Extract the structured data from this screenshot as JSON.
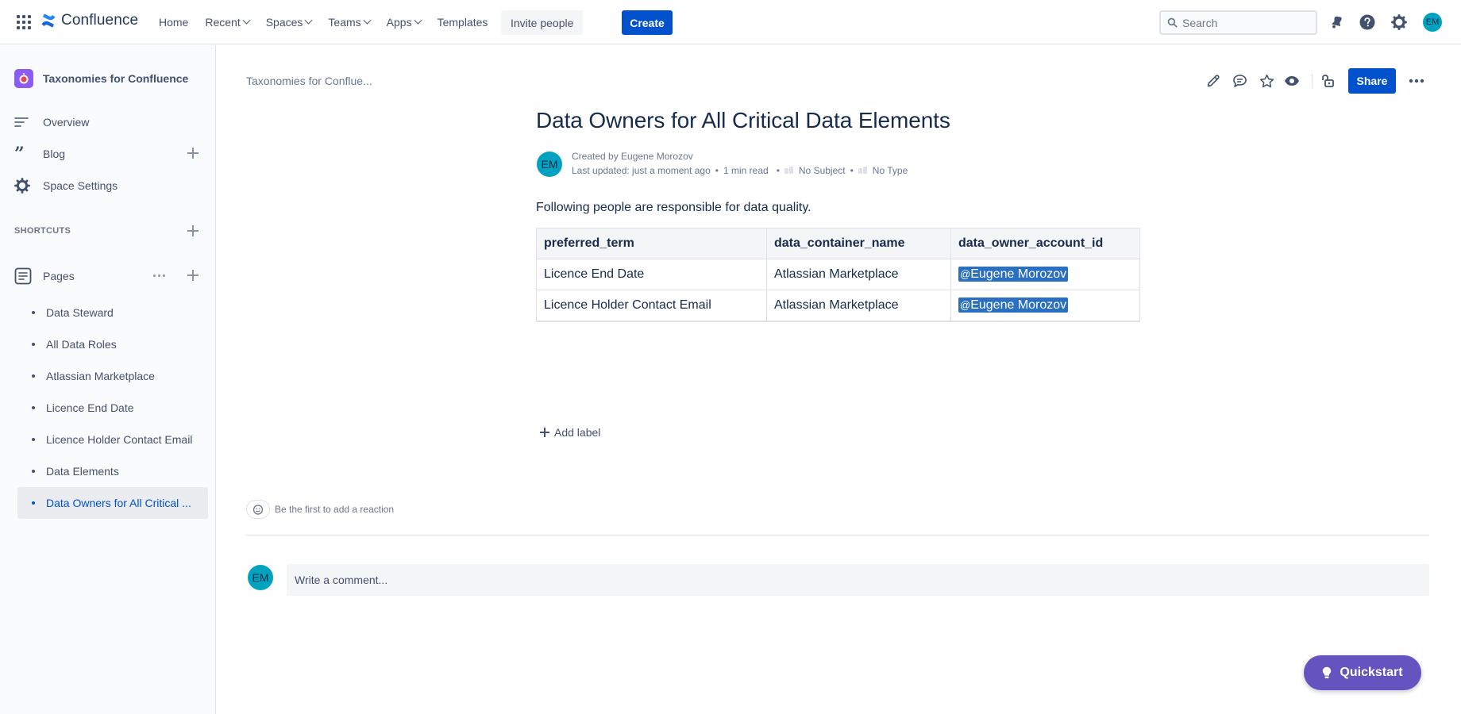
{
  "topbar": {
    "logo_text": "Confluence",
    "nav": [
      {
        "label": "Home",
        "has_chevron": false
      },
      {
        "label": "Recent",
        "has_chevron": true
      },
      {
        "label": "Spaces",
        "has_chevron": true
      },
      {
        "label": "Teams",
        "has_chevron": true
      },
      {
        "label": "Apps",
        "has_chevron": true
      },
      {
        "label": "Templates",
        "has_chevron": false
      }
    ],
    "invite_label": "Invite people",
    "create_label": "Create",
    "search_placeholder": "Search",
    "user_initials": "EM",
    "icons": [
      "apps-grid-icon",
      "confluence-logo-icon",
      "search-icon",
      "notifications-icon",
      "help-icon",
      "settings-icon"
    ]
  },
  "sidebar": {
    "space_name": "Taxonomies for Confluence",
    "items": [
      {
        "label": "Overview",
        "icon": "overview-icon"
      },
      {
        "label": "Blog",
        "icon": "blog-icon"
      },
      {
        "label": "Space Settings",
        "icon": "settings-icon"
      }
    ],
    "shortcuts_label": "SHORTCUTS",
    "pages_label": "Pages",
    "pages": [
      {
        "label": "Data Steward",
        "active": false
      },
      {
        "label": "All Data Roles",
        "active": false
      },
      {
        "label": "Atlassian Marketplace",
        "active": false
      },
      {
        "label": "Licence End Date",
        "active": false
      },
      {
        "label": "Licence Holder Contact Email",
        "active": false
      },
      {
        "label": "Data Elements",
        "active": false
      },
      {
        "label": "Data Owners for All Critical ...",
        "active": true
      }
    ]
  },
  "page": {
    "breadcrumb": "Taxonomies for Conflue...",
    "share_label": "Share",
    "title": "Data Owners for All Critical Data Elements",
    "byline": {
      "created_by": "Created by Eugene Morozov",
      "last_updated": "Last updated: just a moment ago",
      "read_time": "1 min read",
      "subject": "No Subject",
      "type": "No Type",
      "author_initials": "EM"
    },
    "intro": "Following people are responsible for data quality.",
    "table": {
      "headers": [
        "preferred_term",
        "data_container_name",
        "data_owner_account_id"
      ],
      "rows": [
        [
          "Licence End Date",
          "Atlassian Marketplace",
          "Eugene Morozov"
        ],
        [
          "Licence Holder Contact Email",
          "Atlassian Marketplace",
          "Eugene Morozov"
        ]
      ]
    },
    "add_label": "Add label",
    "reaction_text": "Be the first to add a reaction",
    "comment_placeholder": "Write a comment...",
    "comment_avatar_initials": "EM"
  },
  "quickstart_label": "Quickstart",
  "colors": {
    "accent": "#0052cc",
    "mention_bg": "#2b6fc0",
    "avatar_bg": "#00a3bf",
    "quickstart_bg": "#6554c0",
    "space_icon_bg": "#8b5cf6"
  }
}
